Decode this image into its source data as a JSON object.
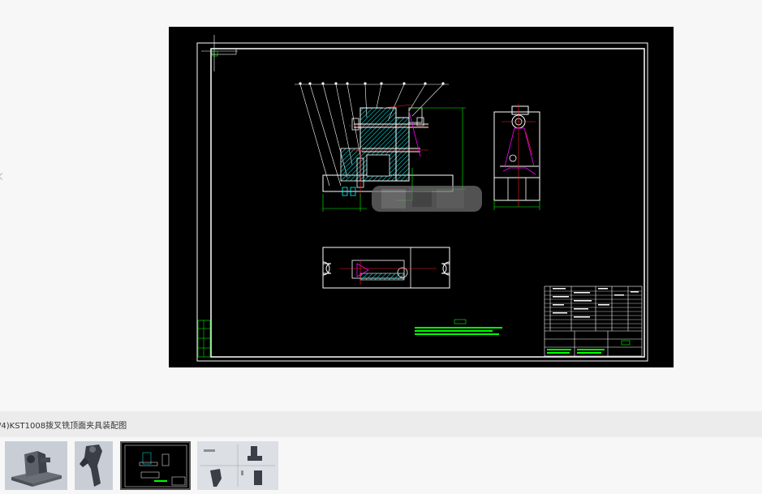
{
  "viewer": {
    "prev_icon": "chevron-left-icon",
    "caption": "/4)KST1008拨叉铣顶面夹具装配图"
  },
  "thumbnails": [
    {
      "name": "thumbnail-3d-fixture-model",
      "active": false
    },
    {
      "name": "thumbnail-fork-part-model",
      "active": false
    },
    {
      "name": "thumbnail-assembly-drawing",
      "active": true
    },
    {
      "name": "thumbnail-part-drawing",
      "active": false
    }
  ],
  "colors": {
    "page_bg": "#f7f7f7",
    "caption_bar_bg": "#ececec",
    "drawing_bg": "#000000",
    "cad_line": "#ffffff",
    "cad_hatch": "#00c8c8",
    "cad_dim": "#00ff00",
    "cad_center": "#ff2020",
    "cad_magenta": "#ff00ff",
    "thumb_bg": "#c9ced6"
  }
}
